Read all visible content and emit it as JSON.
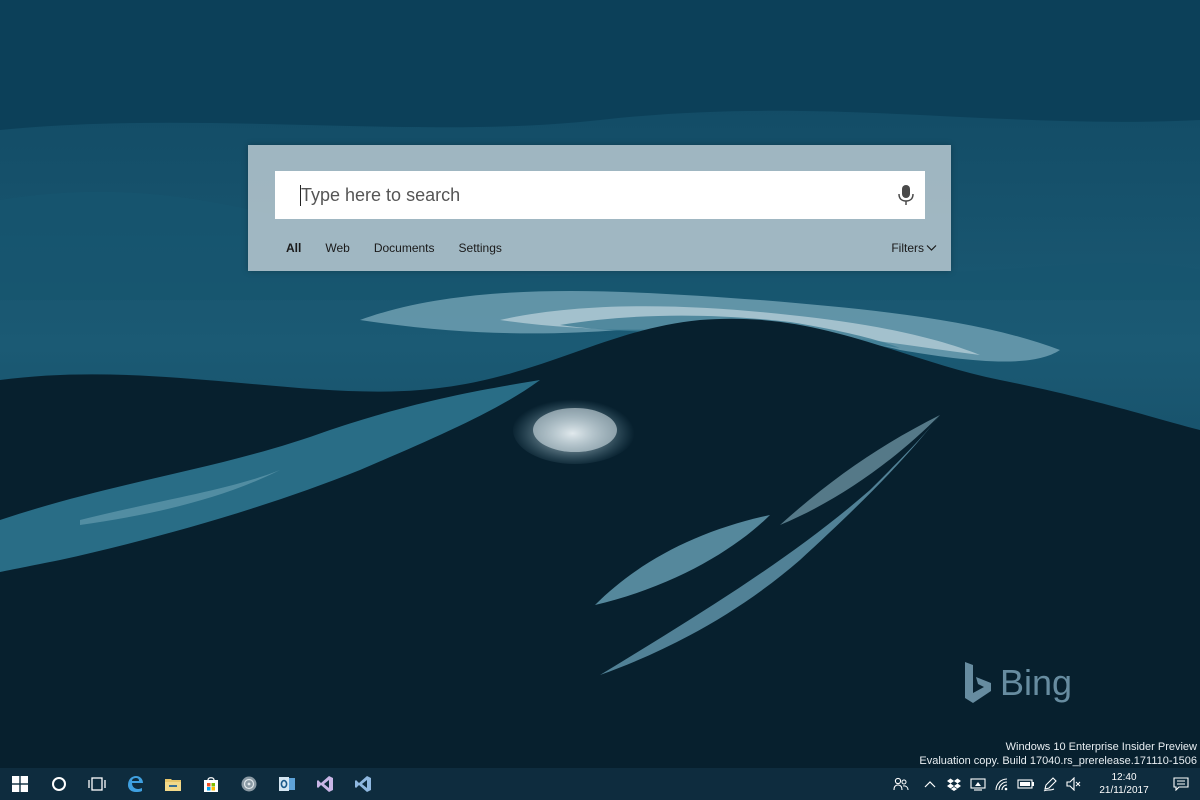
{
  "search": {
    "placeholder": "Type here to search",
    "value": "",
    "tabs": [
      {
        "label": "All",
        "active": true
      },
      {
        "label": "Web",
        "active": false
      },
      {
        "label": "Documents",
        "active": false
      },
      {
        "label": "Settings",
        "active": false
      }
    ],
    "filters_label": "Filters"
  },
  "brand": {
    "bing_text": "Bing"
  },
  "watermark": {
    "line1": "Windows 10 Enterprise Insider Preview",
    "line2": "Evaluation copy. Build 17040.rs_prerelease.171110-1506"
  },
  "taskbar": {
    "apps": [
      "windows-start-icon",
      "cortana-circle-icon",
      "task-view-icon",
      "edge-icon",
      "file-explorer-icon",
      "store-icon",
      "groove-music-icon",
      "outlook-icon",
      "visual-studio-icon",
      "visual-studio-code-icon"
    ],
    "tray": [
      "people-icon",
      "chevron-up-icon",
      "dropbox-icon",
      "onedrive-icon",
      "wifi-icon",
      "battery-icon",
      "pen-icon",
      "volume-muted-icon"
    ],
    "clock": {
      "time": "12:40",
      "date": "21/11/2017"
    }
  },
  "colors": {
    "taskbar": "#0e2c3e",
    "panel": "#becdd4",
    "accent": "#0078d7"
  }
}
